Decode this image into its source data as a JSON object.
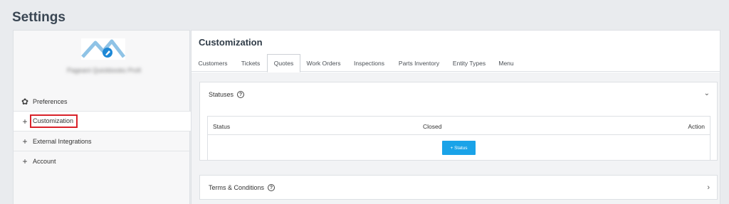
{
  "page": {
    "title": "Settings"
  },
  "sidebar": {
    "org_name": "Pageant Quickbooks Profi",
    "items": [
      {
        "label": "Preferences",
        "icon": "gear-icon"
      },
      {
        "label": "Customization",
        "icon": "plus-icon"
      },
      {
        "label": "External Integrations",
        "icon": "plus-icon"
      },
      {
        "label": "Account",
        "icon": "plus-icon"
      }
    ]
  },
  "main": {
    "title": "Customization",
    "tabs": [
      {
        "label": "Customers"
      },
      {
        "label": "Tickets"
      },
      {
        "label": "Quotes",
        "active": true
      },
      {
        "label": "Work Orders"
      },
      {
        "label": "Inspections"
      },
      {
        "label": "Parts Inventory"
      },
      {
        "label": "Entity Types"
      },
      {
        "label": "Menu"
      }
    ]
  },
  "statuses_panel": {
    "title": "Statuses",
    "columns": [
      "Status",
      "Closed",
      "Action"
    ],
    "add_button": "+ Status"
  },
  "terms_panel": {
    "title": "Terms & Conditions"
  },
  "colors": {
    "accent": "#1aa3e8",
    "highlight": "#d9222a"
  }
}
